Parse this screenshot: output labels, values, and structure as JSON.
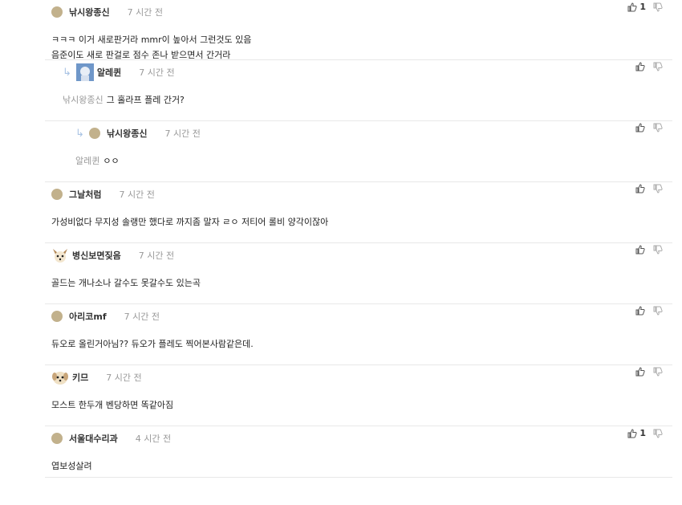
{
  "comments": [
    {
      "nick": "낚시왕종신",
      "time": "7 시간 전",
      "lines": [
        "ㅋㅋㅋ 이거 새로판거라 mmr이 높아서 그런것도 있음",
        "음준이도 새로 판걸로 점수 존나 받으면서 간거라"
      ],
      "likes": "1"
    },
    {
      "nick": "알레퀸",
      "time": "7 시간 전",
      "mention": "낚시왕종신",
      "text": "그 홀라프 플레 간거?"
    },
    {
      "nick": "낚시왕종신",
      "time": "7 시간 전",
      "mention": "알레퀸",
      "text": "ㅇㅇ"
    },
    {
      "nick": "그날처럼",
      "time": "7 시간 전",
      "text": "가성비없다 무지성 솔랭만 했다로 까지좀 말자 ㄹㅇ 저티어 롤비 양각이잖아"
    },
    {
      "nick": "병신보면짖음",
      "time": "7 시간 전",
      "text": "골드는 개나소나 갈수도 못갈수도 있는곡"
    },
    {
      "nick": "아리코mf",
      "time": "7 시간 전",
      "text": "듀오로 올린거아님?? 듀오가 플레도 찍어본사람같은데."
    },
    {
      "nick": "키므",
      "time": "7 시간 전",
      "text": "모스트 한두개 벤당하면 똑같아짐"
    },
    {
      "nick": "서울대수리과",
      "time": "4 시간 전",
      "text": "엽보성살려",
      "likes": "1"
    }
  ]
}
